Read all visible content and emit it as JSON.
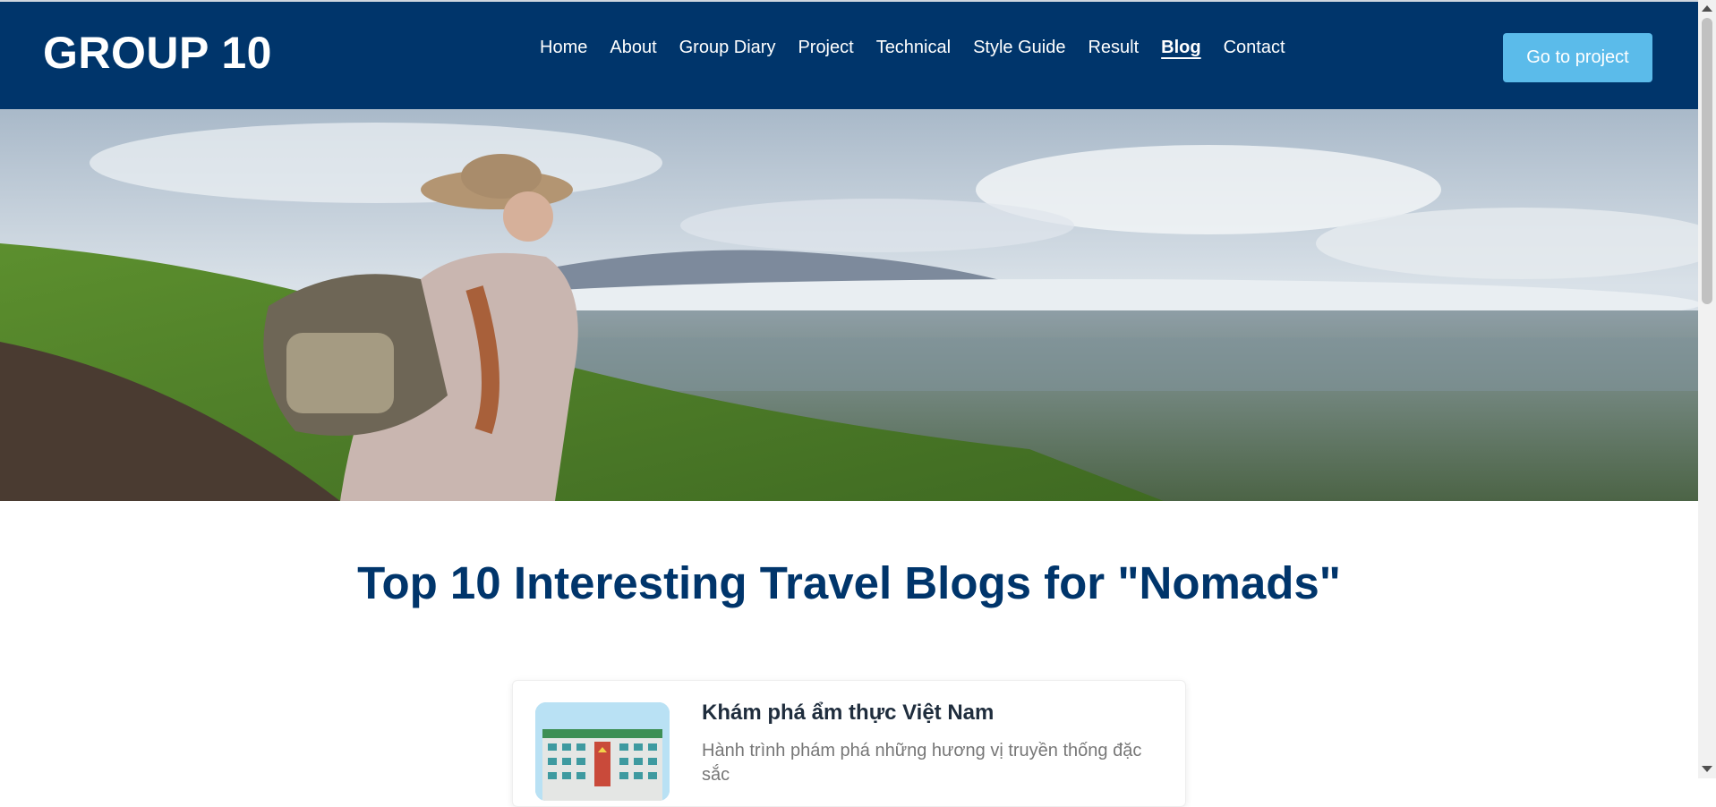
{
  "header": {
    "brand": "GROUP 10",
    "nav": [
      {
        "label": "Home",
        "active": false
      },
      {
        "label": "About",
        "active": false
      },
      {
        "label": "Group Diary",
        "active": false
      },
      {
        "label": "Project",
        "active": false
      },
      {
        "label": "Technical",
        "active": false
      },
      {
        "label": "Style Guide",
        "active": false
      },
      {
        "label": "Result",
        "active": false
      },
      {
        "label": "Blog",
        "active": true
      },
      {
        "label": "Contact",
        "active": false
      }
    ],
    "cta_label": "Go to project"
  },
  "main": {
    "title": "Top 10 Interesting Travel Blogs for \"Nomads\"",
    "posts": [
      {
        "title": "Khám phá ẩm thực Việt Nam",
        "description": "Hành trình phám phá những hương vị truyền thống đặc sắc"
      }
    ]
  },
  "colors": {
    "header_bg": "#00356b",
    "accent": "#5bbbea",
    "title": "#00356b"
  },
  "icons": {
    "hero": "travel-hero-image",
    "thumbnail": "university-building-thumbnail"
  }
}
